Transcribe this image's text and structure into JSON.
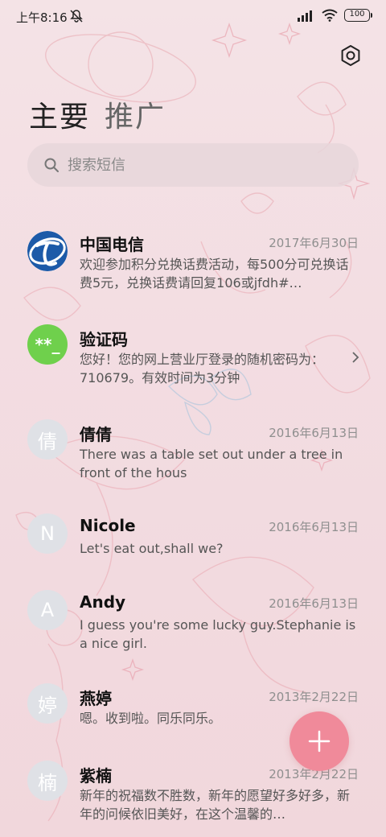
{
  "status_bar": {
    "time": "上午8:16",
    "battery": "100"
  },
  "tabs": [
    {
      "label": "主要"
    },
    {
      "label": "推广"
    }
  ],
  "search": {
    "placeholder": "搜索短信"
  },
  "messages": [
    {
      "sender": "中国电信",
      "date": "2017年6月30日",
      "preview": "欢迎参加积分兑换话费活动，每500分可兑换话费5元，兑换话费请回复106或jfdh#…",
      "avatar": "telecom-logo"
    },
    {
      "sender": "验证码",
      "date": "",
      "preview": "您好！您的网上营业厅登录的随机密码为：710679。有效时间为3分钟",
      "avatar_text": "**_"
    },
    {
      "sender": "倩倩",
      "date": "2016年6月13日",
      "preview": "There was a table set out under a tree in front of the hous",
      "avatar_text": "倩"
    },
    {
      "sender": "Nicole",
      "date": "2016年6月13日",
      "preview": "Let's eat out,shall we?",
      "avatar_text": "N"
    },
    {
      "sender": "Andy",
      "date": "2016年6月13日",
      "preview": "I guess you're some lucky guy.Stephanie is a nice girl.",
      "avatar_text": "A"
    },
    {
      "sender": "燕婷",
      "date": "2013年2月22日",
      "preview": "嗯。收到啦。同乐同乐。",
      "avatar_text": "婷"
    },
    {
      "sender": "紫楠",
      "date": "2013年2月22日",
      "preview": "新年的祝福数不胜数，新年的愿望好多好多，新年的问候依旧美好，在这个温馨的…",
      "avatar_text": "楠"
    }
  ],
  "colors": {
    "fab": "#f08a9a",
    "telecom_blue": "#1c5aa8",
    "verification_green": "#6fd04c",
    "avatar_gray": "#dfe1e6"
  },
  "icons": [
    "mute-icon",
    "signal-icon",
    "wifi-icon",
    "settings-icon",
    "search-icon",
    "chevron-right-icon",
    "plus-icon"
  ]
}
